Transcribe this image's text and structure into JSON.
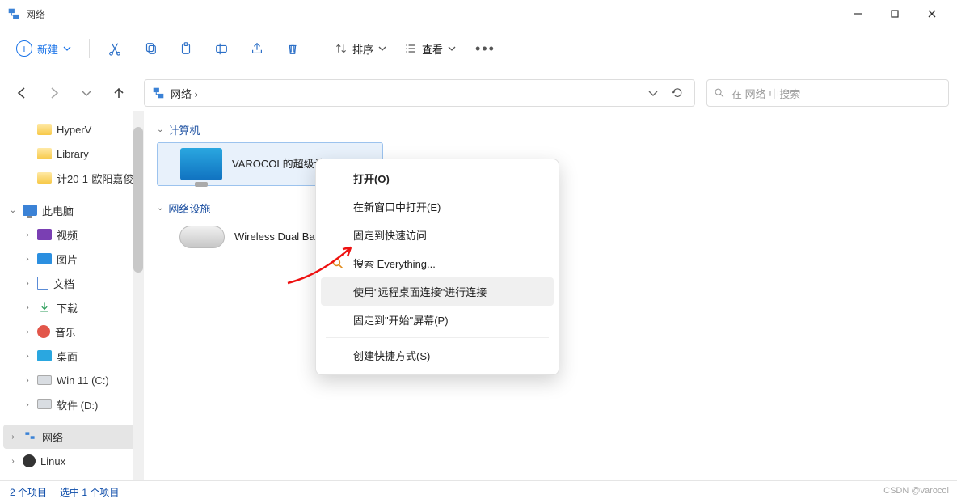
{
  "window": {
    "title": "网络"
  },
  "toolbar": {
    "new_label": "新建",
    "sort_label": "排序",
    "view_label": "查看"
  },
  "address": {
    "path": "网络 ›"
  },
  "search": {
    "placeholder": "在 网络 中搜索"
  },
  "sidebar": {
    "items": [
      {
        "label": "HyperV"
      },
      {
        "label": "Library"
      },
      {
        "label": "计20-1-欧阳嘉俊"
      },
      {
        "label": "此电脑"
      },
      {
        "label": "视频"
      },
      {
        "label": "图片"
      },
      {
        "label": "文档"
      },
      {
        "label": "下载"
      },
      {
        "label": "音乐"
      },
      {
        "label": "桌面"
      },
      {
        "label": "Win 11 (C:)"
      },
      {
        "label": "软件 (D:)"
      },
      {
        "label": "网络"
      },
      {
        "label": "Linux"
      }
    ]
  },
  "content": {
    "group_computers": "计算机",
    "group_network_devices": "网络设施",
    "computer_item": "VAROCOL的超级计",
    "router_item": "Wireless Dual Band Router D12GB"
  },
  "context_menu": {
    "items": [
      "打开(O)",
      "在新窗口中打开(E)",
      "固定到快速访问",
      "搜索 Everything...",
      "使用\"远程桌面连接\"进行连接",
      "固定到\"开始\"屏幕(P)",
      "创建快捷方式(S)"
    ]
  },
  "statusbar": {
    "count": "2 个项目",
    "selected": "选中 1 个项目"
  },
  "watermark": "CSDN @varocol"
}
